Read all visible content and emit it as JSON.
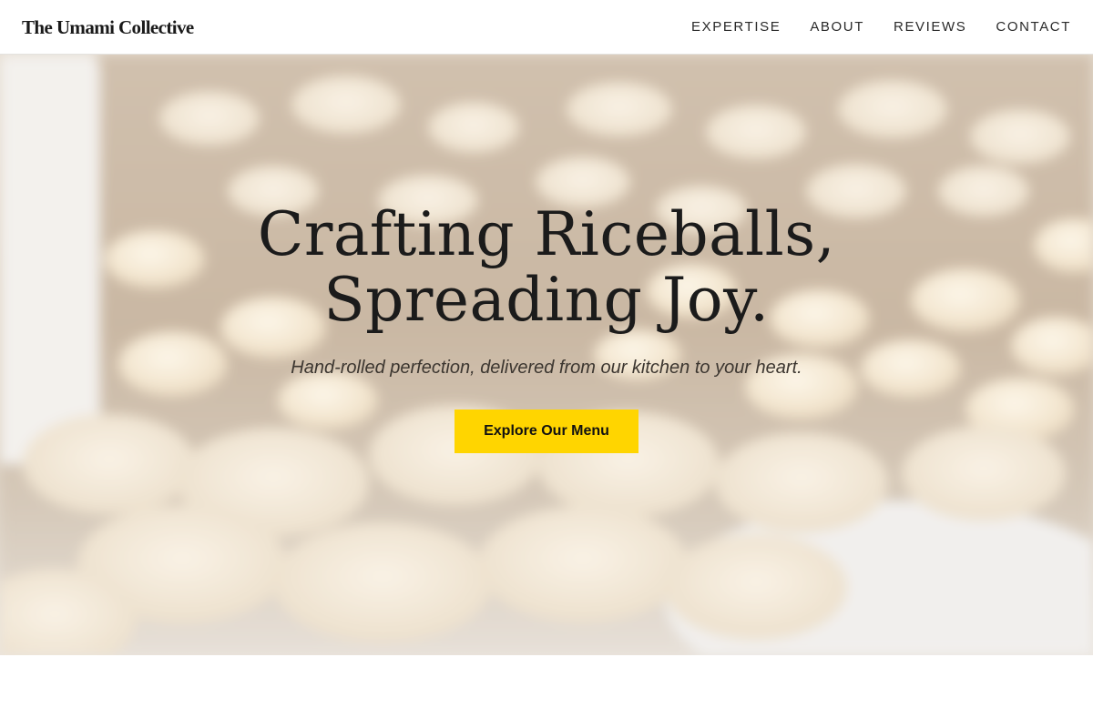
{
  "header": {
    "logo": "The Umami Collective",
    "nav": [
      {
        "label": "EXPERTISE"
      },
      {
        "label": "ABOUT"
      },
      {
        "label": "REVIEWS"
      },
      {
        "label": "CONTACT"
      }
    ]
  },
  "hero": {
    "title_line1": "Crafting Riceballs,",
    "title_line2": "Spreading Joy.",
    "subtitle": "Hand-rolled perfection, delivered from our kitchen to your heart.",
    "cta_label": "Explore Our Menu",
    "background_image": "blurred close-up of peanuts on a wooden surface"
  },
  "colors": {
    "cta_background": "#ffd500",
    "text_dark": "#1b1b1b",
    "header_background": "#ffffff"
  }
}
